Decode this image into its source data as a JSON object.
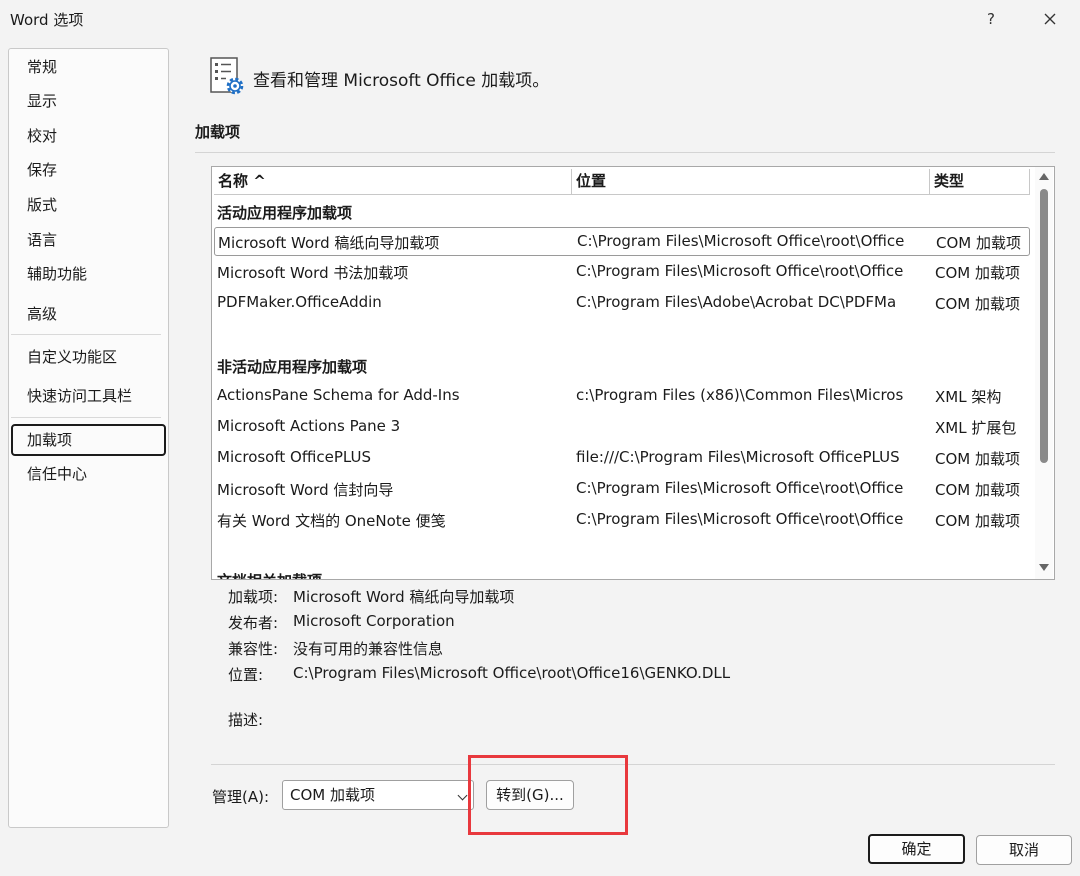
{
  "window": {
    "title": "Word 选项",
    "help_label": "?"
  },
  "sidebar": {
    "items": [
      {
        "label": "常规"
      },
      {
        "label": "显示"
      },
      {
        "label": "校对"
      },
      {
        "label": "保存"
      },
      {
        "label": "版式"
      },
      {
        "label": "语言"
      },
      {
        "label": "辅助功能"
      },
      {
        "label": "高级"
      },
      {
        "label": "自定义功能区"
      },
      {
        "label": "快速访问工具栏"
      },
      {
        "label": "加载项",
        "selected": true
      },
      {
        "label": "信任中心"
      }
    ]
  },
  "header": {
    "text": "查看和管理 Microsoft Office 加载项。",
    "icon": "addins-gear-icon"
  },
  "section": {
    "title": "加载项"
  },
  "table": {
    "columns": {
      "name": "名称 ^",
      "location": "位置",
      "type": "类型"
    },
    "groups": [
      {
        "title": "活动应用程序加载项",
        "rows": [
          {
            "name": "Microsoft Word 稿纸向导加载项",
            "location": "C:\\Program Files\\Microsoft Office\\root\\Office",
            "type": "COM 加载项",
            "focused": true
          },
          {
            "name": "Microsoft Word 书法加载项",
            "location": "C:\\Program Files\\Microsoft Office\\root\\Office",
            "type": "COM 加载项"
          },
          {
            "name": "PDFMaker.OfficeAddin",
            "location": "C:\\Program Files\\Adobe\\Acrobat DC\\PDFMa",
            "type": "COM 加载项"
          }
        ]
      },
      {
        "title": "非活动应用程序加载项",
        "rows": [
          {
            "name": "ActionsPane Schema for Add-Ins",
            "location": "c:\\Program Files (x86)\\Common Files\\Micros",
            "type": "XML 架构"
          },
          {
            "name": "Microsoft Actions Pane 3",
            "location": "",
            "type": "XML 扩展包"
          },
          {
            "name": "Microsoft OfficePLUS",
            "location": "file:///C:\\Program Files\\Microsoft OfficePLUS",
            "type": "COM 加载项"
          },
          {
            "name": "Microsoft Word 信封向导",
            "location": "C:\\Program Files\\Microsoft Office\\root\\Office",
            "type": "COM 加载项"
          },
          {
            "name": "有关 Word 文档的 OneNote 便笺",
            "location": "C:\\Program Files\\Microsoft Office\\root\\Office",
            "type": "COM 加载项"
          }
        ]
      },
      {
        "title": "文档相关加载项",
        "rows": []
      }
    ]
  },
  "details": {
    "addin_label": "加载项:",
    "addin_value": "Microsoft Word 稿纸向导加载项",
    "publisher_label": "发布者:",
    "publisher_value": "Microsoft Corporation",
    "compat_label": "兼容性:",
    "compat_value": "没有可用的兼容性信息",
    "location_label": "位置:",
    "location_value": "C:\\Program Files\\Microsoft Office\\root\\Office16\\GENKO.DLL",
    "desc_label": "描述:"
  },
  "manage": {
    "label": "管理(A):",
    "selected": "COM 加载项",
    "go_label": "转到(G)..."
  },
  "dialog": {
    "ok_label": "确定",
    "cancel_label": "取消"
  },
  "colors": {
    "highlight": "#e8383d",
    "icon_blue": "#1f6fc5"
  }
}
